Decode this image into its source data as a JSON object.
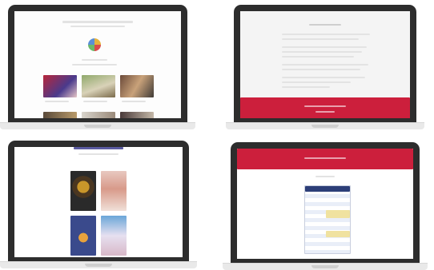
{
  "colors": {
    "bezel": "#2d2d2d",
    "accent_red": "#cc1f3c",
    "screen_bg": "#fbfbfb"
  },
  "devices": [
    {
      "name": "top-left",
      "screen": "landing-page"
    },
    {
      "name": "top-right",
      "screen": "text-page-red-footer"
    },
    {
      "name": "bottom-left",
      "screen": "poster-grid"
    },
    {
      "name": "bottom-right",
      "screen": "red-header-table"
    }
  ]
}
